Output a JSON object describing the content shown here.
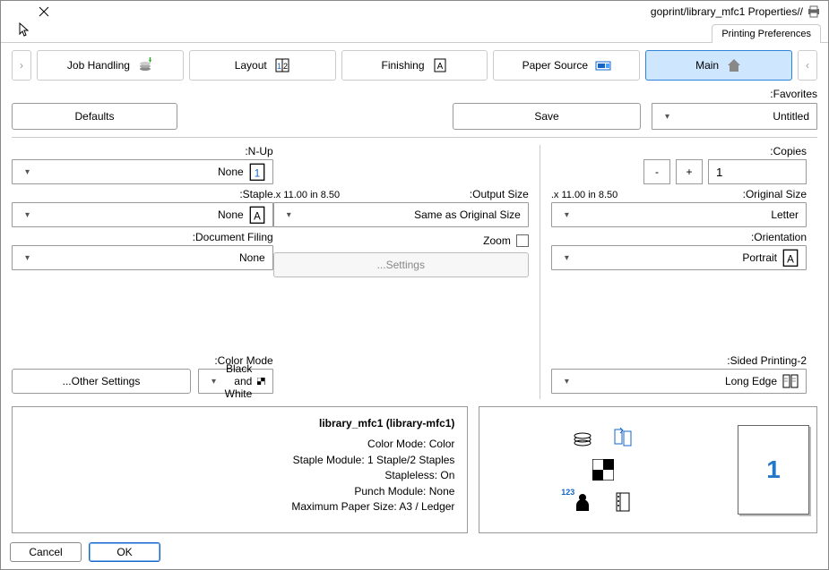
{
  "window": {
    "title": "//goprint/library_mfc1 Properties"
  },
  "tabs": {
    "printing_prefs": "Printing Preferences"
  },
  "nav": {
    "left": "‹",
    "right": "›",
    "items": [
      "Main",
      "Paper Source",
      "Finishing",
      "Layout",
      "Job Handling"
    ]
  },
  "favorites": {
    "label": "Favorites:",
    "value": "Untitled",
    "save": "Save",
    "defaults": "Defaults"
  },
  "copies": {
    "label": "Copies:",
    "value": "1",
    "plus": "+",
    "minus": "-"
  },
  "original_size": {
    "label": "Original Size:",
    "hint": "8.50 x 11.00 in.",
    "value": "Letter"
  },
  "output_size": {
    "label": "Output Size:",
    "hint": "8.50 x 11.00 in.",
    "value": "Same as Original Size"
  },
  "orientation": {
    "label": "Orientation:",
    "value": "Portrait"
  },
  "zoom": {
    "label": "Zoom",
    "settings": "Settings..."
  },
  "two_sided": {
    "label": "2-Sided Printing:",
    "value": "Long Edge"
  },
  "nup": {
    "label": "N-Up:",
    "value": "None"
  },
  "staple": {
    "label": "Staple:",
    "value": "None"
  },
  "doc_filing": {
    "label": "Document Filing:",
    "value": "None"
  },
  "color_mode": {
    "label": "Color Mode:",
    "value": "Black and White"
  },
  "other_settings": "Other Settings...",
  "preview": {
    "title": "library_mfc1 (library-mfc1)",
    "lines": [
      "Color Mode: Color",
      "Staple Module: 1 Staple/2 Staples",
      "Stapleless: On",
      "Punch Module: None",
      "Maximum Paper Size: A3 / Ledger"
    ],
    "thumb_number": "1",
    "pv_label": "123"
  },
  "footer": {
    "ok": "OK",
    "cancel": "Cancel"
  }
}
